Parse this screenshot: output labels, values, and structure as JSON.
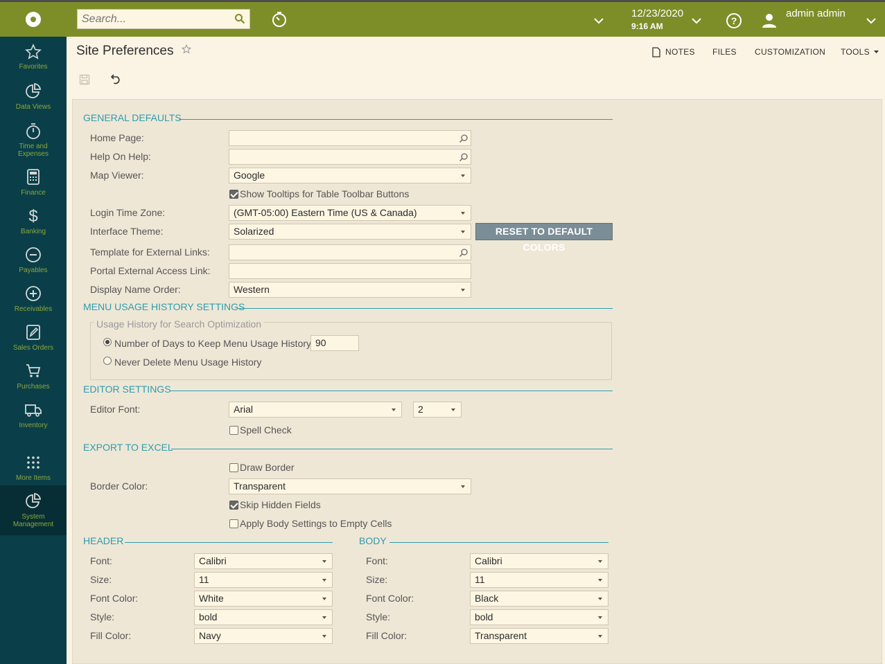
{
  "topbar": {
    "search_placeholder": "Search...",
    "date": "12/23/2020",
    "time": "9:16 AM",
    "user_name": "admin admin"
  },
  "sidebar": {
    "items": [
      {
        "label": "Favorites",
        "icon": "star-icon"
      },
      {
        "label": "Data Views",
        "icon": "pie-chart-icon"
      },
      {
        "label": "Time and Expenses",
        "icon": "stopwatch-icon"
      },
      {
        "label": "Finance",
        "icon": "calculator-icon"
      },
      {
        "label": "Banking",
        "icon": "dollar-icon"
      },
      {
        "label": "Payables",
        "icon": "minus-circle-icon"
      },
      {
        "label": "Receivables",
        "icon": "plus-circle-icon"
      },
      {
        "label": "Sales Orders",
        "icon": "edit-icon"
      },
      {
        "label": "Purchases",
        "icon": "cart-icon"
      },
      {
        "label": "Inventory",
        "icon": "truck-icon"
      },
      {
        "label": "More Items",
        "icon": "grid-dots-icon"
      },
      {
        "label": "System Management",
        "icon": "pie-chart-icon"
      }
    ]
  },
  "header": {
    "title": "Site Preferences",
    "links": {
      "notes": "NOTES",
      "files": "FILES",
      "customization": "CUSTOMIZATION",
      "tools": "TOOLS"
    }
  },
  "general": {
    "section": "GENERAL DEFAULTS",
    "home_page_label": "Home Page:",
    "home_page_value": "",
    "help_on_help_label": "Help On Help:",
    "help_on_help_value": "",
    "map_viewer_label": "Map Viewer:",
    "map_viewer_value": "Google",
    "show_tooltips_label": "Show Tooltips for Table Toolbar Buttons",
    "login_tz_label": "Login Time Zone:",
    "login_tz_value": "(GMT-05:00) Eastern Time (US & Canada)",
    "theme_label": "Interface Theme:",
    "theme_value": "Solarized",
    "reset_colors": "RESET TO DEFAULT COLORS",
    "template_links_label": "Template for External Links:",
    "template_links_value": "",
    "portal_link_label": "Portal External Access Link:",
    "portal_link_value": "",
    "name_order_label": "Display Name Order:",
    "name_order_value": "Western"
  },
  "menu_usage": {
    "section": "MENU USAGE HISTORY SETTINGS",
    "group": "Usage History for Search Optimization",
    "keep_days_label": "Number of Days to Keep Menu Usage History:",
    "keep_days_value": "90",
    "never_delete_label": "Never Delete Menu Usage History"
  },
  "editor": {
    "section": "EDITOR SETTINGS",
    "font_label": "Editor Font:",
    "font_value": "Arial",
    "size_value": "2",
    "spell_check_label": "Spell Check"
  },
  "excel": {
    "section": "EXPORT TO EXCEL",
    "draw_border_label": "Draw Border",
    "border_color_label": "Border Color:",
    "border_color_value": "Transparent",
    "skip_hidden_label": "Skip Hidden Fields",
    "apply_body_label": "Apply Body Settings to Empty Cells"
  },
  "header_settings": {
    "section": "HEADER",
    "font_label": "Font:",
    "font_value": "Calibri",
    "size_label": "Size:",
    "size_value": "11",
    "font_color_label": "Font Color:",
    "font_color_value": "White",
    "style_label": "Style:",
    "style_value": "bold",
    "fill_color_label": "Fill Color:",
    "fill_color_value": "Navy"
  },
  "body_settings": {
    "section": "BODY",
    "font_label": "Font:",
    "font_value": "Calibri",
    "size_label": "Size:",
    "size_value": "11",
    "font_color_label": "Font Color:",
    "font_color_value": "Black",
    "style_label": "Style:",
    "style_value": "bold",
    "fill_color_label": "Fill Color:",
    "fill_color_value": "Transparent"
  },
  "colors": {
    "topbar": "#7d8e28",
    "sidebar": "#0a3f49",
    "accent": "#2e9cad",
    "panel": "#eee7d6"
  }
}
